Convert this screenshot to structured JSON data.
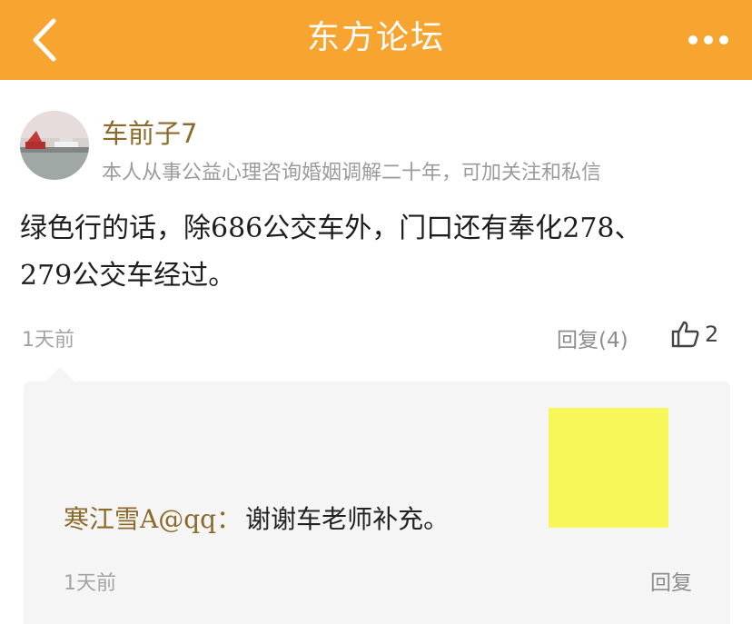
{
  "header": {
    "title": "东方论坛",
    "background_color": "#f7a530",
    "back_icon": "chevron-left-icon",
    "more_icon": "more-dots-icon"
  },
  "post": {
    "username": "车前子7",
    "bio": "本人从事公益心理咨询婚姻调解二十年，可加关注和私信",
    "body_line1": "绿色行的话，除686公交车外，门口还有奉化278、",
    "body_line2": "279公交车经过。",
    "time": "1天前",
    "reply_label": "回复(4)",
    "like_icon": "thumbs-up-icon",
    "like_count": "2"
  },
  "reply": {
    "user": "寒江雪A@qq：",
    "text": "谢谢车老师补充。",
    "time": "1天前",
    "reply_label": "回复",
    "highlight_color": "#f7f75a"
  }
}
